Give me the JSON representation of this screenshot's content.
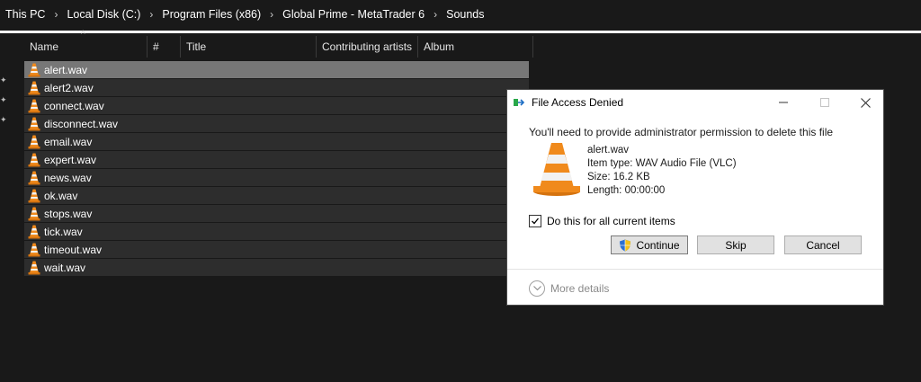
{
  "breadcrumb": [
    "This PC",
    "Local Disk (C:)",
    "Program Files (x86)",
    "Global Prime - MetaTrader 6",
    "Sounds"
  ],
  "columns": {
    "name": "Name",
    "number": "#",
    "title": "Title",
    "artists": "Contributing artists",
    "album": "Album"
  },
  "files": [
    {
      "name": "alert.wav",
      "selected": true
    },
    {
      "name": "alert2.wav"
    },
    {
      "name": "connect.wav"
    },
    {
      "name": "disconnect.wav"
    },
    {
      "name": "email.wav"
    },
    {
      "name": "expert.wav"
    },
    {
      "name": "news.wav"
    },
    {
      "name": "ok.wav"
    },
    {
      "name": "stops.wav"
    },
    {
      "name": "tick.wav"
    },
    {
      "name": "timeout.wav"
    },
    {
      "name": "wait.wav"
    }
  ],
  "dialog": {
    "title": "File Access Denied",
    "message": "You'll need to provide administrator permission to delete this file",
    "file_name": "alert.wav",
    "item_type": "Item type: WAV Audio File (VLC)",
    "size": "Size: 16.2 KB",
    "length": "Length: 00:00:00",
    "checkbox_label": "Do this for all current items",
    "checkbox_checked": true,
    "buttons": {
      "continue": "Continue",
      "skip": "Skip",
      "cancel": "Cancel"
    },
    "more_details": "More details"
  },
  "colors": {
    "background": "#191919",
    "row": "#2d2d2d",
    "row_selected": "#777777",
    "cone_orange": "#f08a1c"
  },
  "icons": {
    "file": "vlc-cone-icon",
    "pin": "pin-icon",
    "dialog_app": "file-move-icon",
    "uac": "shield-icon",
    "expand": "chevron-down-icon"
  }
}
